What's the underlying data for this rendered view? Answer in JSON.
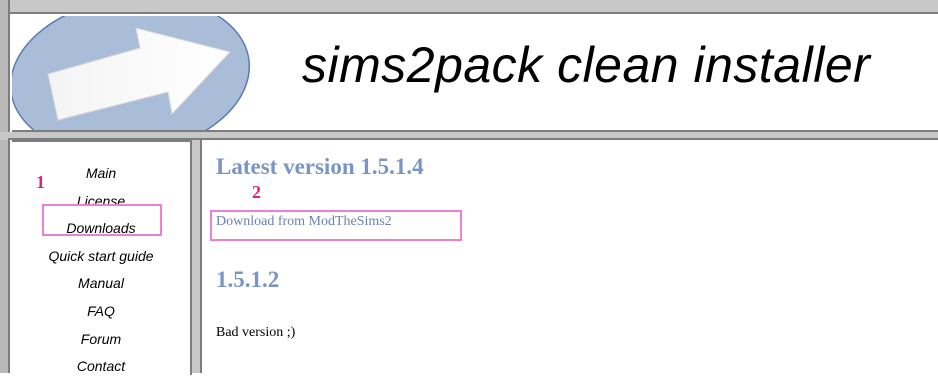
{
  "header": {
    "title": "sims2pack clean installer"
  },
  "sidebar": {
    "items": [
      {
        "label": "Main"
      },
      {
        "label": "License"
      },
      {
        "label": "Downloads"
      },
      {
        "label": "Quick start guide"
      },
      {
        "label": "Manual"
      },
      {
        "label": "FAQ"
      },
      {
        "label": "Forum"
      },
      {
        "label": "Contact"
      }
    ]
  },
  "content": {
    "latest_heading": "Latest version 1.5.1.4",
    "download_link": "Download from ModTheSims2",
    "old_heading": "1.5.1.2",
    "old_note": "Bad version ;)"
  },
  "annotations": {
    "marker_1": "1",
    "marker_2": "2"
  },
  "colors": {
    "heading": "#7a95c5",
    "link": "#6e7fb3",
    "annotation": "#f07fd2",
    "annotation_number": "#e0207f",
    "frame": "#c8c8c8"
  },
  "icons": {
    "logo": "arrow-in-ellipse-icon"
  }
}
